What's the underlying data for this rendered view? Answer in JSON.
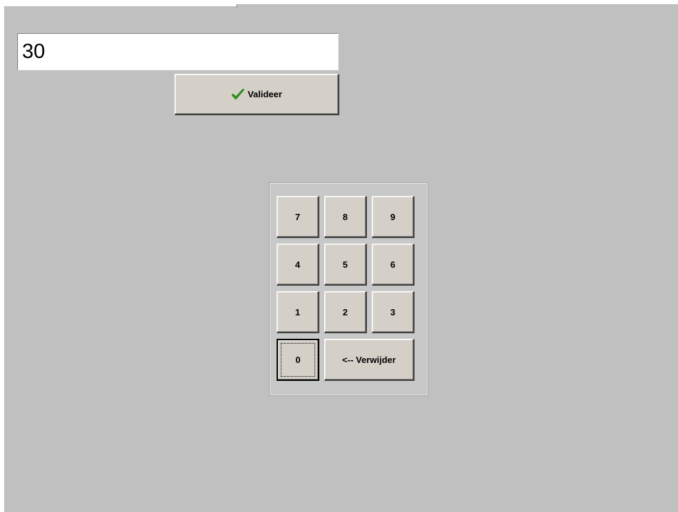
{
  "amount_input": {
    "value": "30"
  },
  "validate_button": {
    "label": "Valideer",
    "icon": "check-icon",
    "icon_color": "#2e9a1a"
  },
  "keypad": {
    "keys": [
      {
        "label": "7"
      },
      {
        "label": "8"
      },
      {
        "label": "9"
      },
      {
        "label": "4"
      },
      {
        "label": "5"
      },
      {
        "label": "6"
      },
      {
        "label": "1"
      },
      {
        "label": "2"
      },
      {
        "label": "3"
      },
      {
        "label": "0"
      },
      {
        "label": "<-- Verwijder"
      }
    ]
  },
  "colors": {
    "background": "#c0c0c0",
    "button_face": "#d4d0c8"
  }
}
